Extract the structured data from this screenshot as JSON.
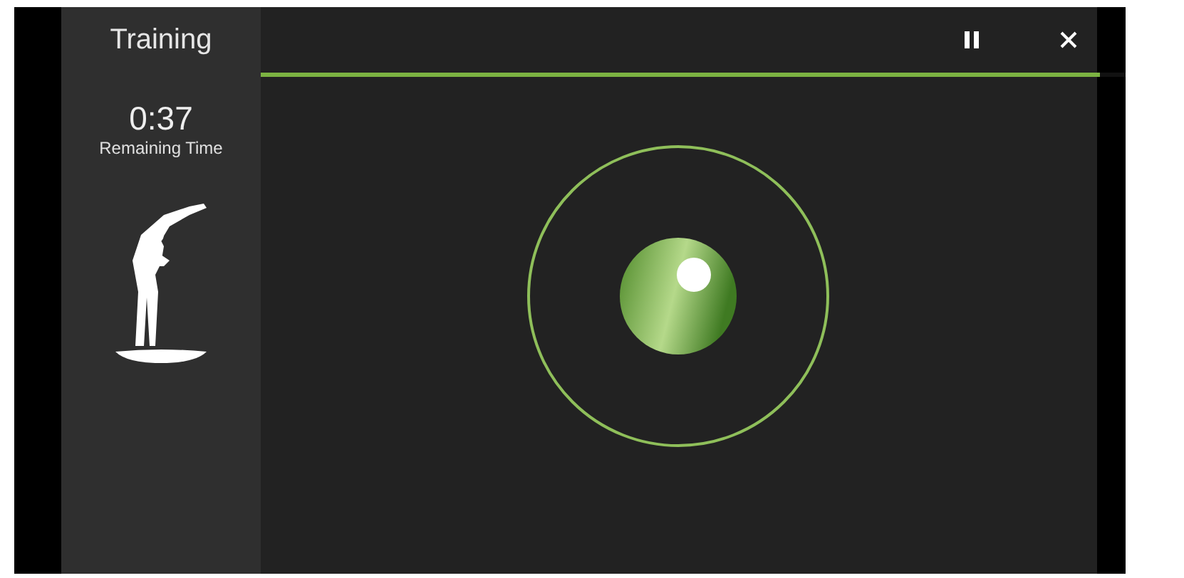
{
  "sidebar": {
    "title": "Training",
    "remaining_time": "0:37",
    "remaining_label": "Remaining Time"
  },
  "progress": {
    "level": 0.97
  }
}
